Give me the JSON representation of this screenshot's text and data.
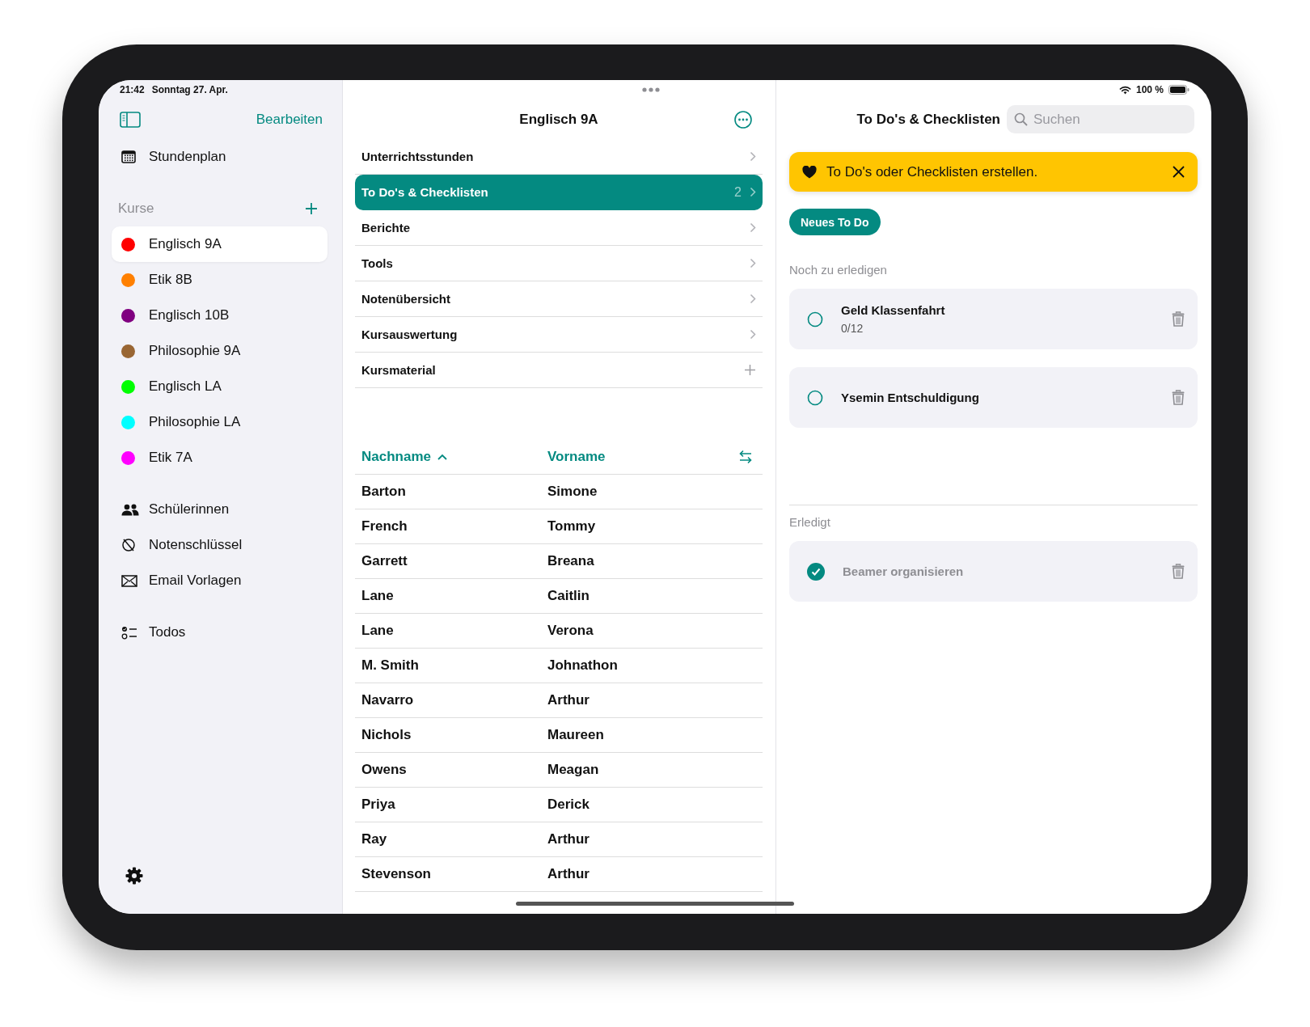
{
  "status_bar": {
    "time": "21:42",
    "date": "Sonntag 27. Apr.",
    "battery": "100 %"
  },
  "sidebar": {
    "edit_label": "Bearbeiten",
    "top_items": [
      {
        "label": "Stundenplan",
        "kind": "calendar"
      }
    ],
    "courses_header": "Kurse",
    "courses": [
      {
        "label": "Englisch 9A",
        "color": "#ff0000",
        "selected": true
      },
      {
        "label": "Etik 8B",
        "color": "#ff8000",
        "selected": false
      },
      {
        "label": "Englisch 10B",
        "color": "#800080",
        "selected": false
      },
      {
        "label": "Philosophie 9A",
        "color": "#996633",
        "selected": false
      },
      {
        "label": "Englisch LA",
        "color": "#00ff00",
        "selected": false
      },
      {
        "label": "Philosophie LA",
        "color": "#00ffff",
        "selected": false
      },
      {
        "label": "Etik 7A",
        "color": "#ff00ff",
        "selected": false
      }
    ],
    "nav_items": [
      {
        "label": "Schülerinnen",
        "kind": "people"
      },
      {
        "label": "Notenschlüssel",
        "kind": "nosign"
      },
      {
        "label": "Email Vorlagen",
        "kind": "envelope"
      }
    ],
    "extra_items": [
      {
        "label": "Todos",
        "kind": "checklist"
      }
    ]
  },
  "course": {
    "title": "Englisch 9A",
    "menu": [
      {
        "label": "Unterrichtsstunden",
        "kind": "chevron",
        "selected": false
      },
      {
        "label": "To Do's & Checklisten",
        "count": "2",
        "kind": "chevron",
        "selected": true
      },
      {
        "label": "Berichte",
        "kind": "chevron",
        "selected": false
      },
      {
        "label": "Tools",
        "kind": "chevron",
        "selected": false
      },
      {
        "label": "Notenübersicht",
        "kind": "chevron",
        "selected": false
      },
      {
        "label": "Kursauswertung",
        "kind": "chevron",
        "selected": false
      },
      {
        "label": "Kursmaterial",
        "kind": "add",
        "selected": false
      }
    ],
    "table": {
      "columns": [
        {
          "label": "Nachname",
          "sorted": true
        },
        {
          "label": "Vorname",
          "sorted": false
        }
      ],
      "rows": [
        [
          "Barton",
          "Simone"
        ],
        [
          "French",
          "Tommy"
        ],
        [
          "Garrett",
          "Breana"
        ],
        [
          "Lane",
          "Caitlin"
        ],
        [
          "Lane",
          "Verona"
        ],
        [
          "M. Smith",
          "Johnathon"
        ],
        [
          "Navarro",
          "Arthur"
        ],
        [
          "Nichols",
          "Maureen"
        ],
        [
          "Owens",
          "Meagan"
        ],
        [
          "Priya",
          "Derick"
        ],
        [
          "Ray",
          "Arthur"
        ],
        [
          "Stevenson",
          "Arthur"
        ]
      ]
    }
  },
  "todos": {
    "title": "To Do's & Checklisten",
    "search": {
      "placeholder": "Suchen"
    },
    "banner": "To Do's oder Checklisten erstellen.",
    "new_button": "Neues To Do",
    "sections": [
      {
        "title": "Noch zu erledigen",
        "items": [
          {
            "title": "Geld Klassenfahrt",
            "subtitle": "0/12",
            "checked": false
          },
          {
            "title": "Ysemin Entschuldigung",
            "checked": false
          }
        ]
      },
      {
        "title": "Erledigt",
        "items": [
          {
            "title": "Beamer organisieren",
            "checked": true
          }
        ]
      }
    ]
  }
}
